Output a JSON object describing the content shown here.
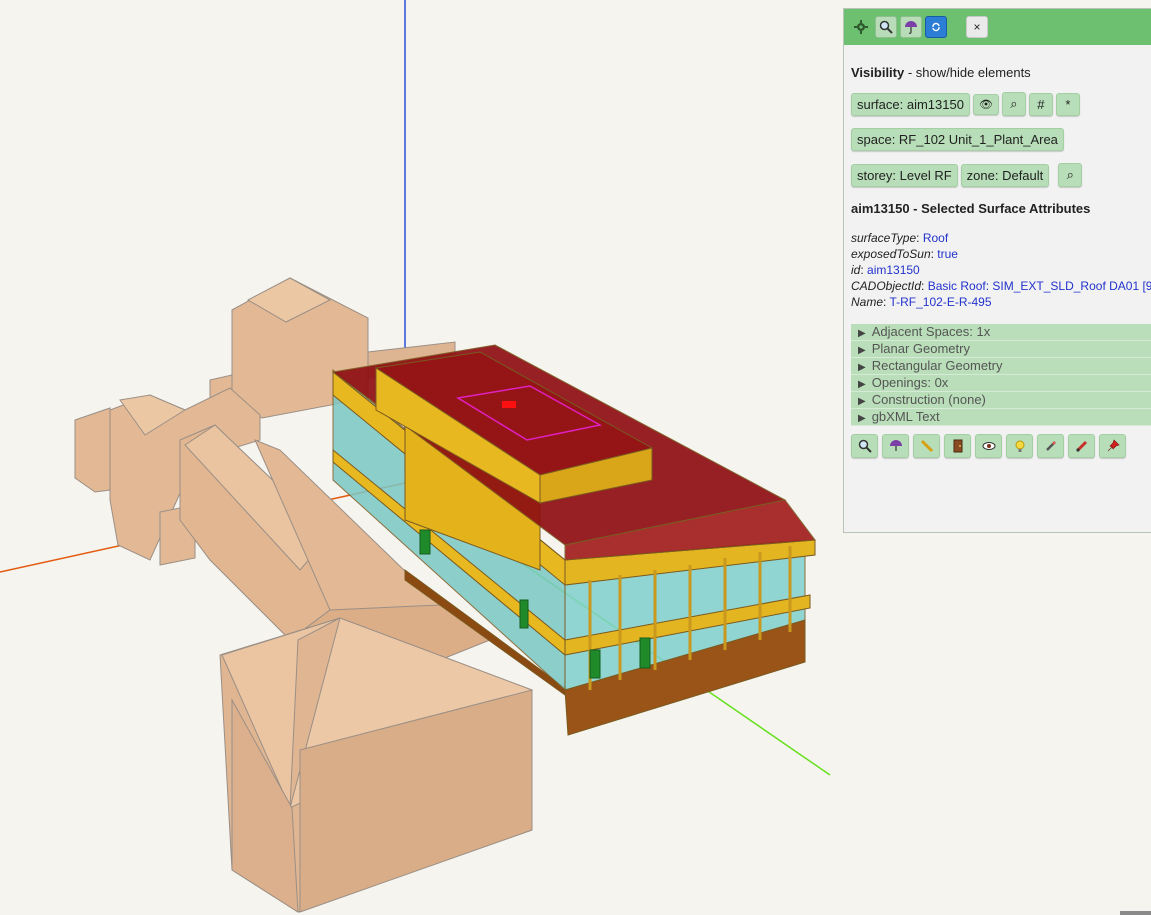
{
  "panel": {
    "header_icons": [
      "gear-icon",
      "search-icon",
      "umbrella-icon",
      "sync-icon"
    ],
    "close_label": "×",
    "visibility": {
      "title": "Visibility",
      "subtitle": " - show/hide elements"
    },
    "surface_chip": "surface: aim13150",
    "surface_tools": [
      "👁",
      "⌕",
      "#",
      "*"
    ],
    "space_chip": "space: RF_102 Unit_1_Plant_Area",
    "storey_chip": "storey: Level RF",
    "zone_chip": "zone: Default",
    "zone_tool": "⌕",
    "selected_title": "aim13150 - Selected Surface Attributes",
    "attributes": [
      {
        "key": "surfaceType",
        "value": "Roof"
      },
      {
        "key": "exposedToSun",
        "value": "true"
      },
      {
        "key": "id",
        "value": "aim13150"
      },
      {
        "key": "CADObjectId",
        "value": "Basic Roof: SIM_EXT_SLD_Roof DA01 [9"
      },
      {
        "key": "Name",
        "value": "T-RF_102-E-R-495"
      }
    ],
    "details": [
      "Adjacent Spaces: 1x",
      "Planar Geometry",
      "Rectangular Geometry",
      "Openings: 0x",
      "Construction (none)",
      "gbXML Text"
    ],
    "toolbar_icons": [
      "search-icon",
      "umbrella-icon",
      "ruler-icon",
      "door-icon",
      "eye-icon",
      "bulb-icon",
      "pencil-icon",
      "brush-icon",
      "pin-icon"
    ]
  }
}
